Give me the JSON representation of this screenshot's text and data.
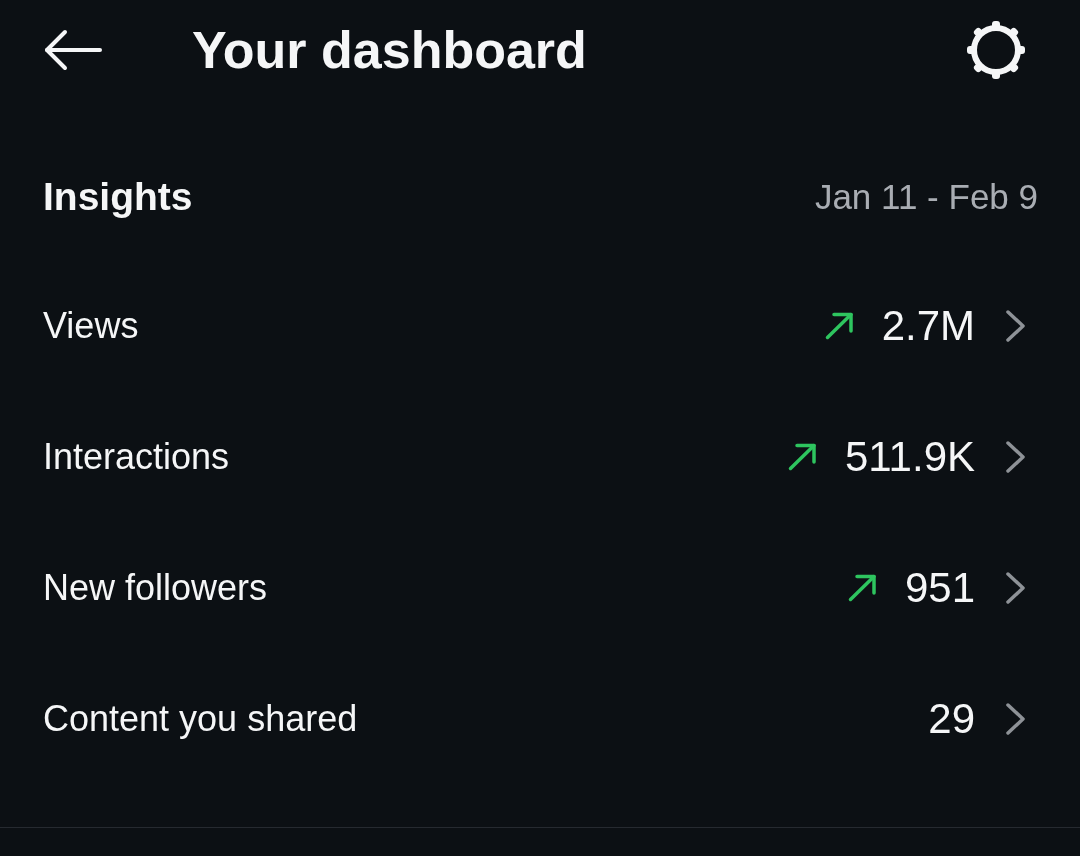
{
  "header": {
    "title": "Your dashboard"
  },
  "insights": {
    "title": "Insights",
    "date_range": "Jan 11 - Feb 9"
  },
  "metrics": [
    {
      "label": "Views",
      "value": "2.7M",
      "trending_up": true
    },
    {
      "label": "Interactions",
      "value": "511.9K",
      "trending_up": true
    },
    {
      "label": "New followers",
      "value": "951",
      "trending_up": true
    },
    {
      "label": "Content you shared",
      "value": "29",
      "trending_up": false
    }
  ]
}
